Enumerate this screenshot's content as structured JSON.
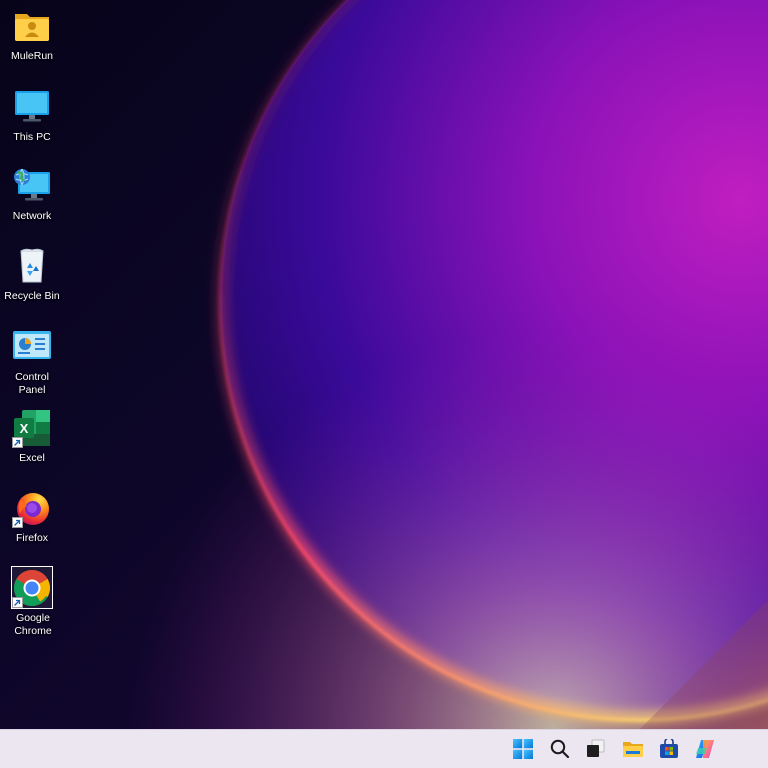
{
  "desktop": {
    "icons": [
      {
        "label": "MuleRun",
        "icon": "user-folder-icon"
      },
      {
        "label": "This PC",
        "icon": "monitor-icon"
      },
      {
        "label": "Network",
        "icon": "network-icon"
      },
      {
        "label": "Recycle Bin",
        "icon": "recycle-bin-icon"
      },
      {
        "label": "Control Panel",
        "icon": "control-panel-icon"
      },
      {
        "label": "Excel",
        "icon": "excel-icon",
        "shortcut": true
      },
      {
        "label": "Firefox",
        "icon": "firefox-icon",
        "shortcut": true
      },
      {
        "label": "Google Chrome",
        "icon": "chrome-icon",
        "shortcut": true,
        "selected": true
      }
    ]
  },
  "taskbar": {
    "items": [
      {
        "name": "start-button",
        "icon": "windows-logo-icon"
      },
      {
        "name": "search-button",
        "icon": "search-icon"
      },
      {
        "name": "task-view-button",
        "icon": "task-view-icon"
      },
      {
        "name": "file-explorer-button",
        "icon": "folder-icon"
      },
      {
        "name": "microsoft-store-button",
        "icon": "store-icon"
      },
      {
        "name": "copilot-button",
        "icon": "copilot-icon"
      }
    ]
  },
  "colors": {
    "taskbar_bg": "#ece6f0",
    "wallpaper_dark": "#0b0520",
    "wallpaper_accent": "#b01ab8",
    "glow": "#ffd36a"
  }
}
